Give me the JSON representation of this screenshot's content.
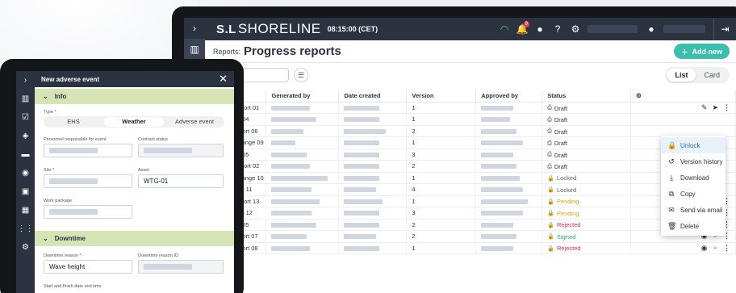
{
  "app": {
    "brand": "SHORELINE",
    "brand_mark": "S.L",
    "clock": "08:15:00 (CET)",
    "notification_count": "9"
  },
  "page": {
    "label": "Reports:",
    "title": "Progress reports",
    "add_button": "Add new",
    "view_list": "List",
    "view_card": "Card"
  },
  "columns": [
    "ort title",
    "Generated by",
    "Date created",
    "Version",
    "Approved by",
    "Status"
  ],
  "rows": [
    {
      "title": "issioning report 01",
      "version": "1",
      "status": "Draft",
      "kind": "draft"
    },
    {
      "title": "ation report 04",
      "version": "1",
      "status": "Draft",
      "kind": "draft"
    },
    {
      "title": "ssembly report 06",
      "version": "2",
      "status": "Draft",
      "kind": "draft"
    },
    {
      "title": "former exchange 09",
      "version": "1",
      "status": "Draft",
      "kind": "draft"
    },
    {
      "title": "ation report 05",
      "version": "3",
      "status": "Draft",
      "kind": "draft"
    },
    {
      "title": "issioning report 02",
      "version": "2",
      "status": "Draft",
      "kind": "draft"
    },
    {
      "title": "former exchange 10",
      "version": "1",
      "status": "Locked",
      "kind": "locked"
    },
    {
      "title": "ox exchange 11",
      "version": "4",
      "status": "Locked",
      "kind": "locked"
    },
    {
      "title": "issioning report 13",
      "version": "1",
      "status": "Pending",
      "kind": "pending"
    },
    {
      "title": "ox exchange 12",
      "version": "3",
      "status": "Pending",
      "kind": "pending"
    },
    {
      "title": "ation report 05",
      "version": "2",
      "status": "Rejected",
      "kind": "rejected"
    },
    {
      "title": "ssembly report 07",
      "version": "2",
      "status": "Signed",
      "kind": "signed"
    },
    {
      "title": "ssembly report 08",
      "version": "1",
      "status": "Rejected",
      "kind": "rejected"
    }
  ],
  "menu": [
    "Unlock",
    "Version history",
    "Download",
    "Copy",
    "Send via email",
    "Delete"
  ],
  "form": {
    "title": "New adverse event",
    "section_info": "Info",
    "type_label": "Type *",
    "type_options": [
      "EHS",
      "Weather",
      "Adverse event"
    ],
    "personnel_label": "Personnel responsible for event",
    "contract_label": "Contract status",
    "site_label": "Site *",
    "asset_label": "Asset",
    "asset_value": "WTG-01",
    "workpackage_label": "Work package",
    "section_downtime": "Downtime",
    "reason_label": "Downtime reason *",
    "reason_value": "Wave height",
    "reason_id_label": "Downtime reason ID",
    "startfinish_label": "Start and finish date and time"
  },
  "colors": {
    "dark": "#2c3340",
    "accent": "#3bbfad",
    "section": "#d6e4b5",
    "pending": "#e8a317",
    "rejected": "#d8304a",
    "signed": "#2fa864"
  }
}
